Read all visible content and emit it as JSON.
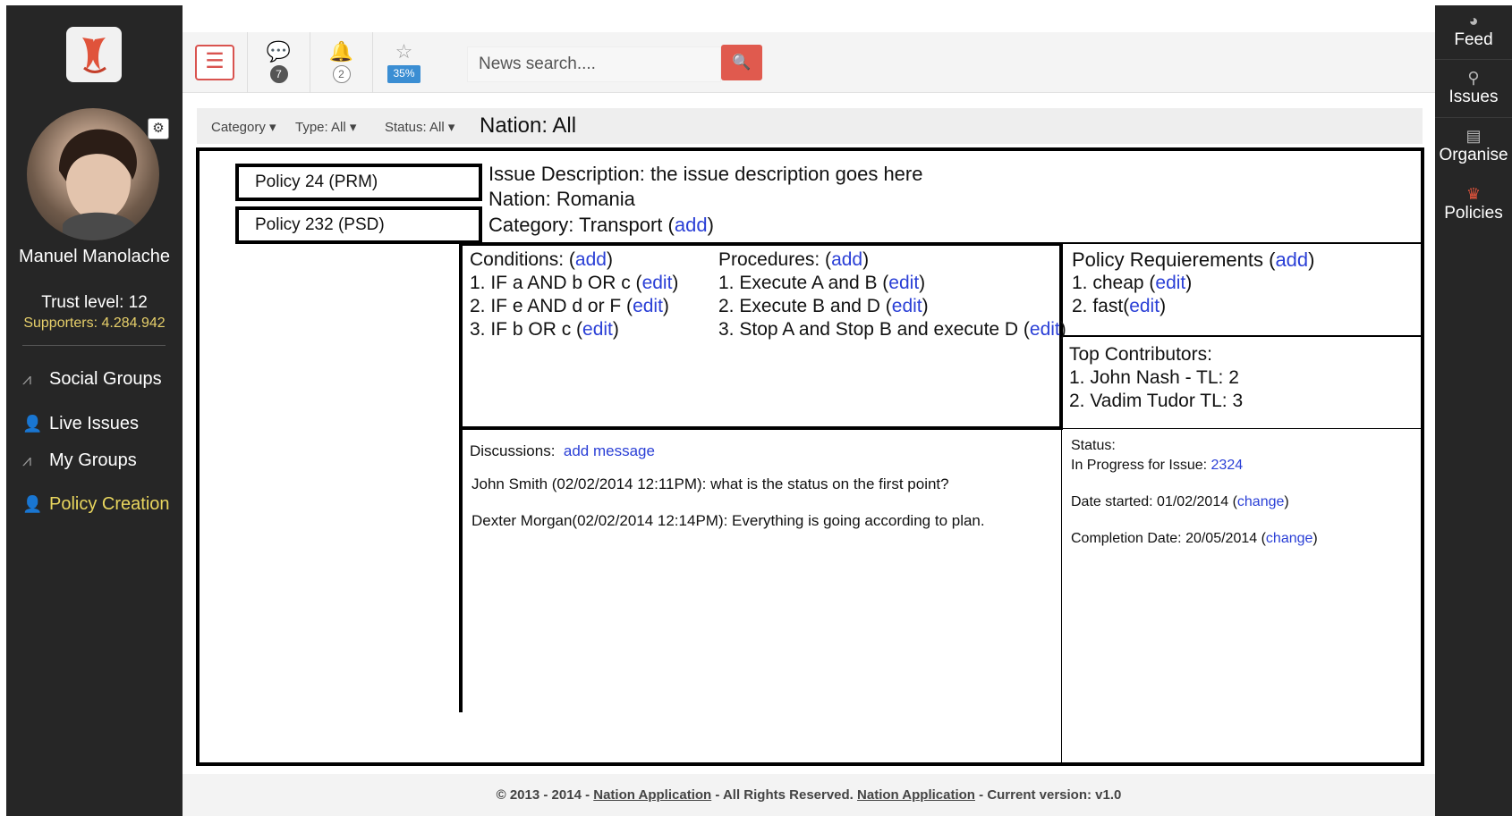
{
  "user": {
    "name": "Manuel Manolache",
    "trust_level": "Trust level: 12",
    "supporters": "Supporters: 4.284.942"
  },
  "sidebar": {
    "items": [
      {
        "label": "Social Groups",
        "icon": "pulse-icon"
      },
      {
        "label": "Live Issues",
        "icon": "user-icon"
      },
      {
        "label": "My Groups",
        "icon": "pulse-icon"
      },
      {
        "label": "Policy Creation",
        "icon": "user-icon",
        "active": true
      }
    ]
  },
  "right_nav": {
    "items": [
      {
        "label": "Feed",
        "icon": "globe-icon"
      },
      {
        "label": "Issues",
        "icon": "pin-icon"
      },
      {
        "label": "Organise",
        "icon": "calendar-icon"
      },
      {
        "label": "Policies",
        "icon": "crown-icon"
      }
    ]
  },
  "header": {
    "messages_count": "7",
    "notifications_count": "2",
    "progress_badge": "35%",
    "search_placeholder": "News search...."
  },
  "filters": {
    "category": "Category",
    "type": "Type: All",
    "status": "Status: All",
    "nation": "Nation: All"
  },
  "policies": [
    "Policy 24 (PRM)",
    "Policy 232 (PSD)"
  ],
  "issue": {
    "description": "Issue Description:  the issue description goes here",
    "nation": "Nation: Romania",
    "category_prefix": "Category: Transport (",
    "category_link": "add",
    "category_suffix": ")"
  },
  "conditions": {
    "title": "Conditions:  (",
    "add": "add",
    "items": [
      "1. IF a AND b OR c  (",
      "2. IF e AND d or F (",
      "3. IF b OR c ("
    ],
    "edit": "edit"
  },
  "procedures": {
    "title": "Procedures: (",
    "add": "add",
    "items": [
      "1. Execute A and B  (",
      "2. Execute B and D  (",
      "3. Stop A and Stop B and execute D  ("
    ],
    "edit": "edit"
  },
  "requirements": {
    "title": "Policy Requierements (",
    "add": "add",
    "items": [
      "1. cheap (",
      "2. fast("
    ],
    "edit": "edit"
  },
  "contributors": {
    "title": "Top Contributors:",
    "items": [
      "1. John Nash  - TL: 2",
      "2. Vadim Tudor TL: 3"
    ]
  },
  "discussions": {
    "title": "Discussions:",
    "add_message": "add message",
    "messages": [
      "John Smith (02/02/2014 12:11PM): what is the status on the first point?",
      "Dexter Morgan(02/02/2014 12:14PM): Everything is going according to plan."
    ]
  },
  "status": {
    "title": "Status:",
    "progress_prefix": "In Progress for Issue: ",
    "issue_number": "2324",
    "date_started": "Date started: 01/02/2014 (",
    "completion_date": "Completion Date: 20/05/2014 (",
    "change": "change"
  },
  "footer": {
    "prefix": "© 2013 - 2014 - ",
    "app_link": "Nation Application",
    "middle": " - All Rights Reserved. ",
    "suffix": " - Current version: v1.0"
  },
  "colors": {
    "sidebar_bg": "#262626",
    "link": "#2a3fd6",
    "accent_red": "#e05a4e",
    "active_yellow": "#e9d65e"
  }
}
